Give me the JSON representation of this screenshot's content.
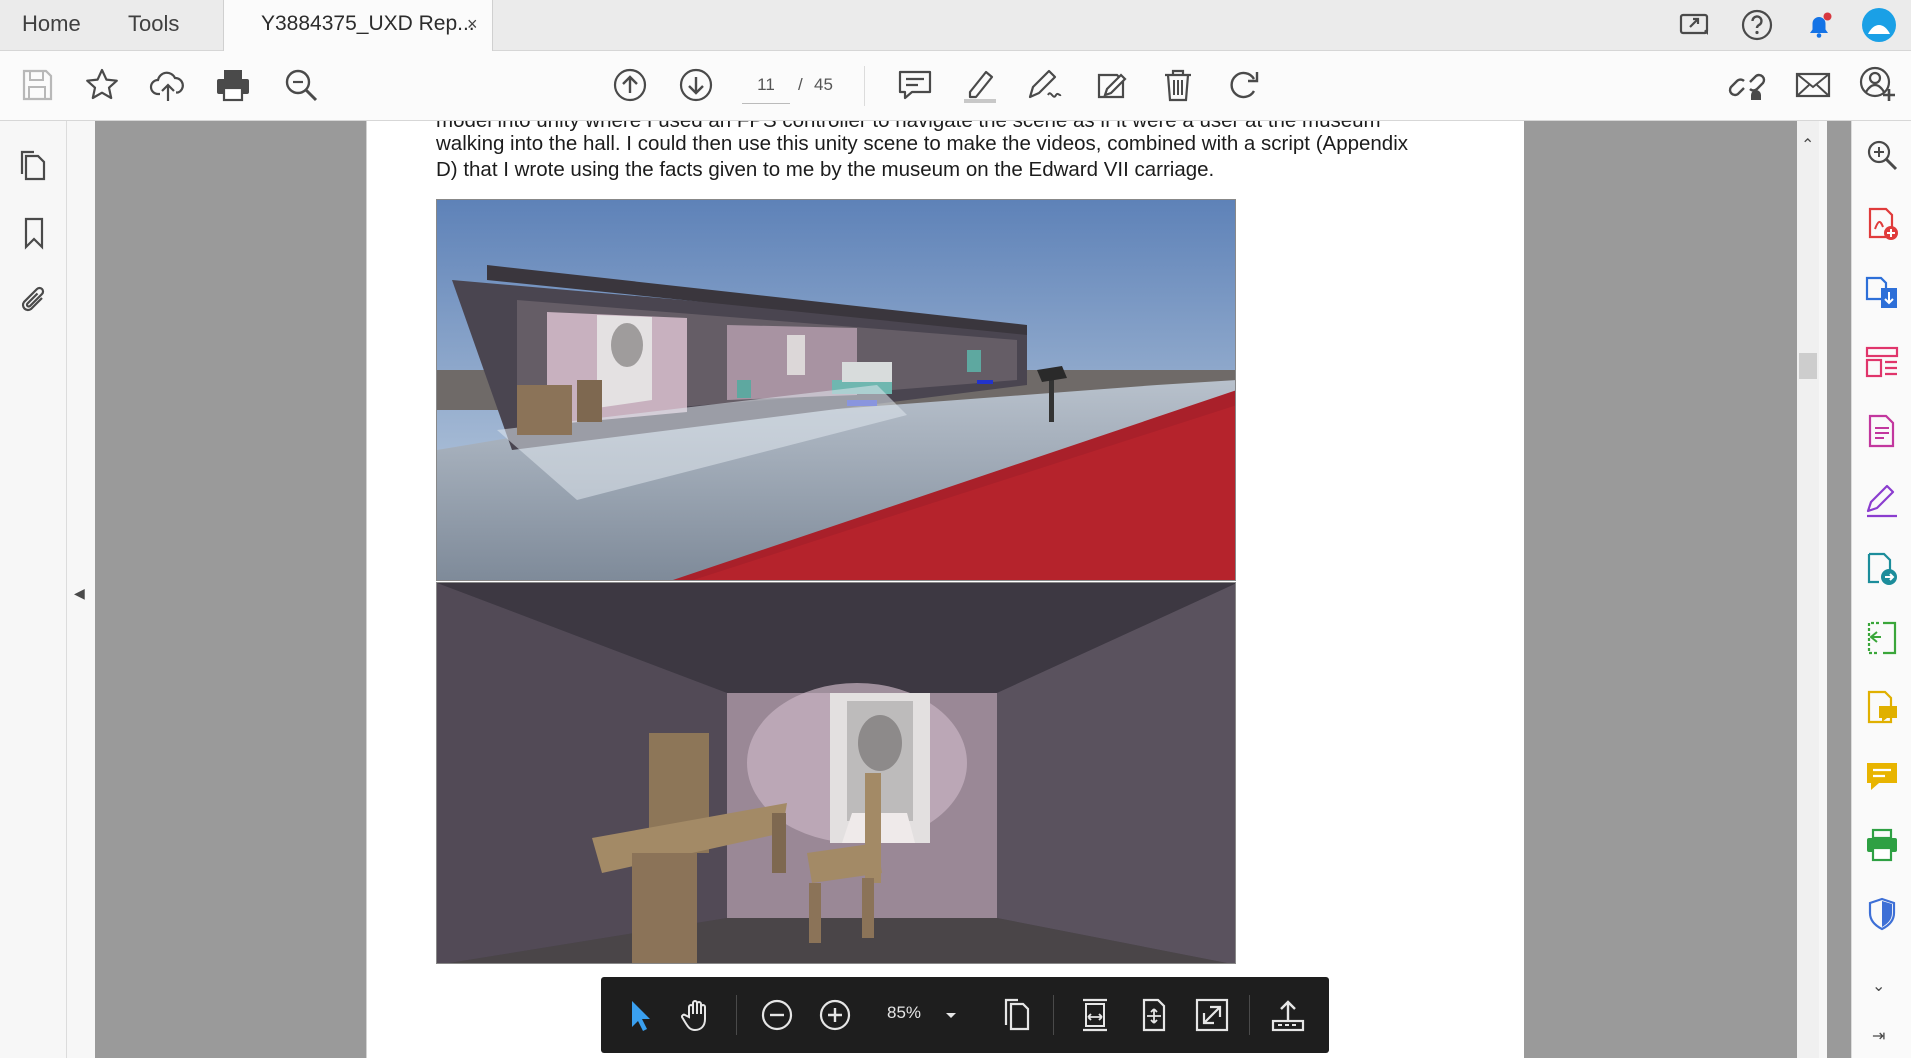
{
  "nav": {
    "home": "Home",
    "tools": "Tools"
  },
  "tab": {
    "title": "Y3884375_UXD Rep...",
    "close": "×"
  },
  "toolbar": {
    "page_current": "11",
    "page_sep": "/",
    "page_total": "45"
  },
  "document": {
    "line1": "model into unity where I used an FPS controller to navigate the scene as if it were a user at the museum",
    "line2": "walking into the hall. I could then use this unity scene to make the videos, combined with a script (Appendix",
    "line3": "D) that I wrote using the facts given to me by the museum on the Edward VII carriage."
  },
  "zoombar": {
    "zoom": "85%"
  },
  "colors": {
    "accent": "#1473e6",
    "highlight_blue": "#1aa0e6",
    "notification_red": "#d7373f"
  },
  "icons": {
    "top": [
      "share-screen-icon",
      "help-icon",
      "bell-icon",
      "profile-icon"
    ],
    "toolbar": [
      "save-icon",
      "star-icon",
      "cloud-upload-icon",
      "print-icon",
      "zoom-search-icon",
      "page-up-icon",
      "page-down-icon",
      "comment-icon",
      "highlighter-icon",
      "sign-pen-icon",
      "edit-pdf-icon",
      "delete-icon",
      "rotate-icon",
      "link-icon",
      "mail-icon",
      "add-user-icon"
    ],
    "right_panel": [
      "zoom-in-icon",
      "create-pdf-icon",
      "export-pdf-icon",
      "organize-icon",
      "edit-icon",
      "fill-sign-icon",
      "send-icon",
      "compress-icon",
      "comment-tool-icon",
      "message-icon",
      "print-production-icon",
      "protect-icon"
    ]
  }
}
